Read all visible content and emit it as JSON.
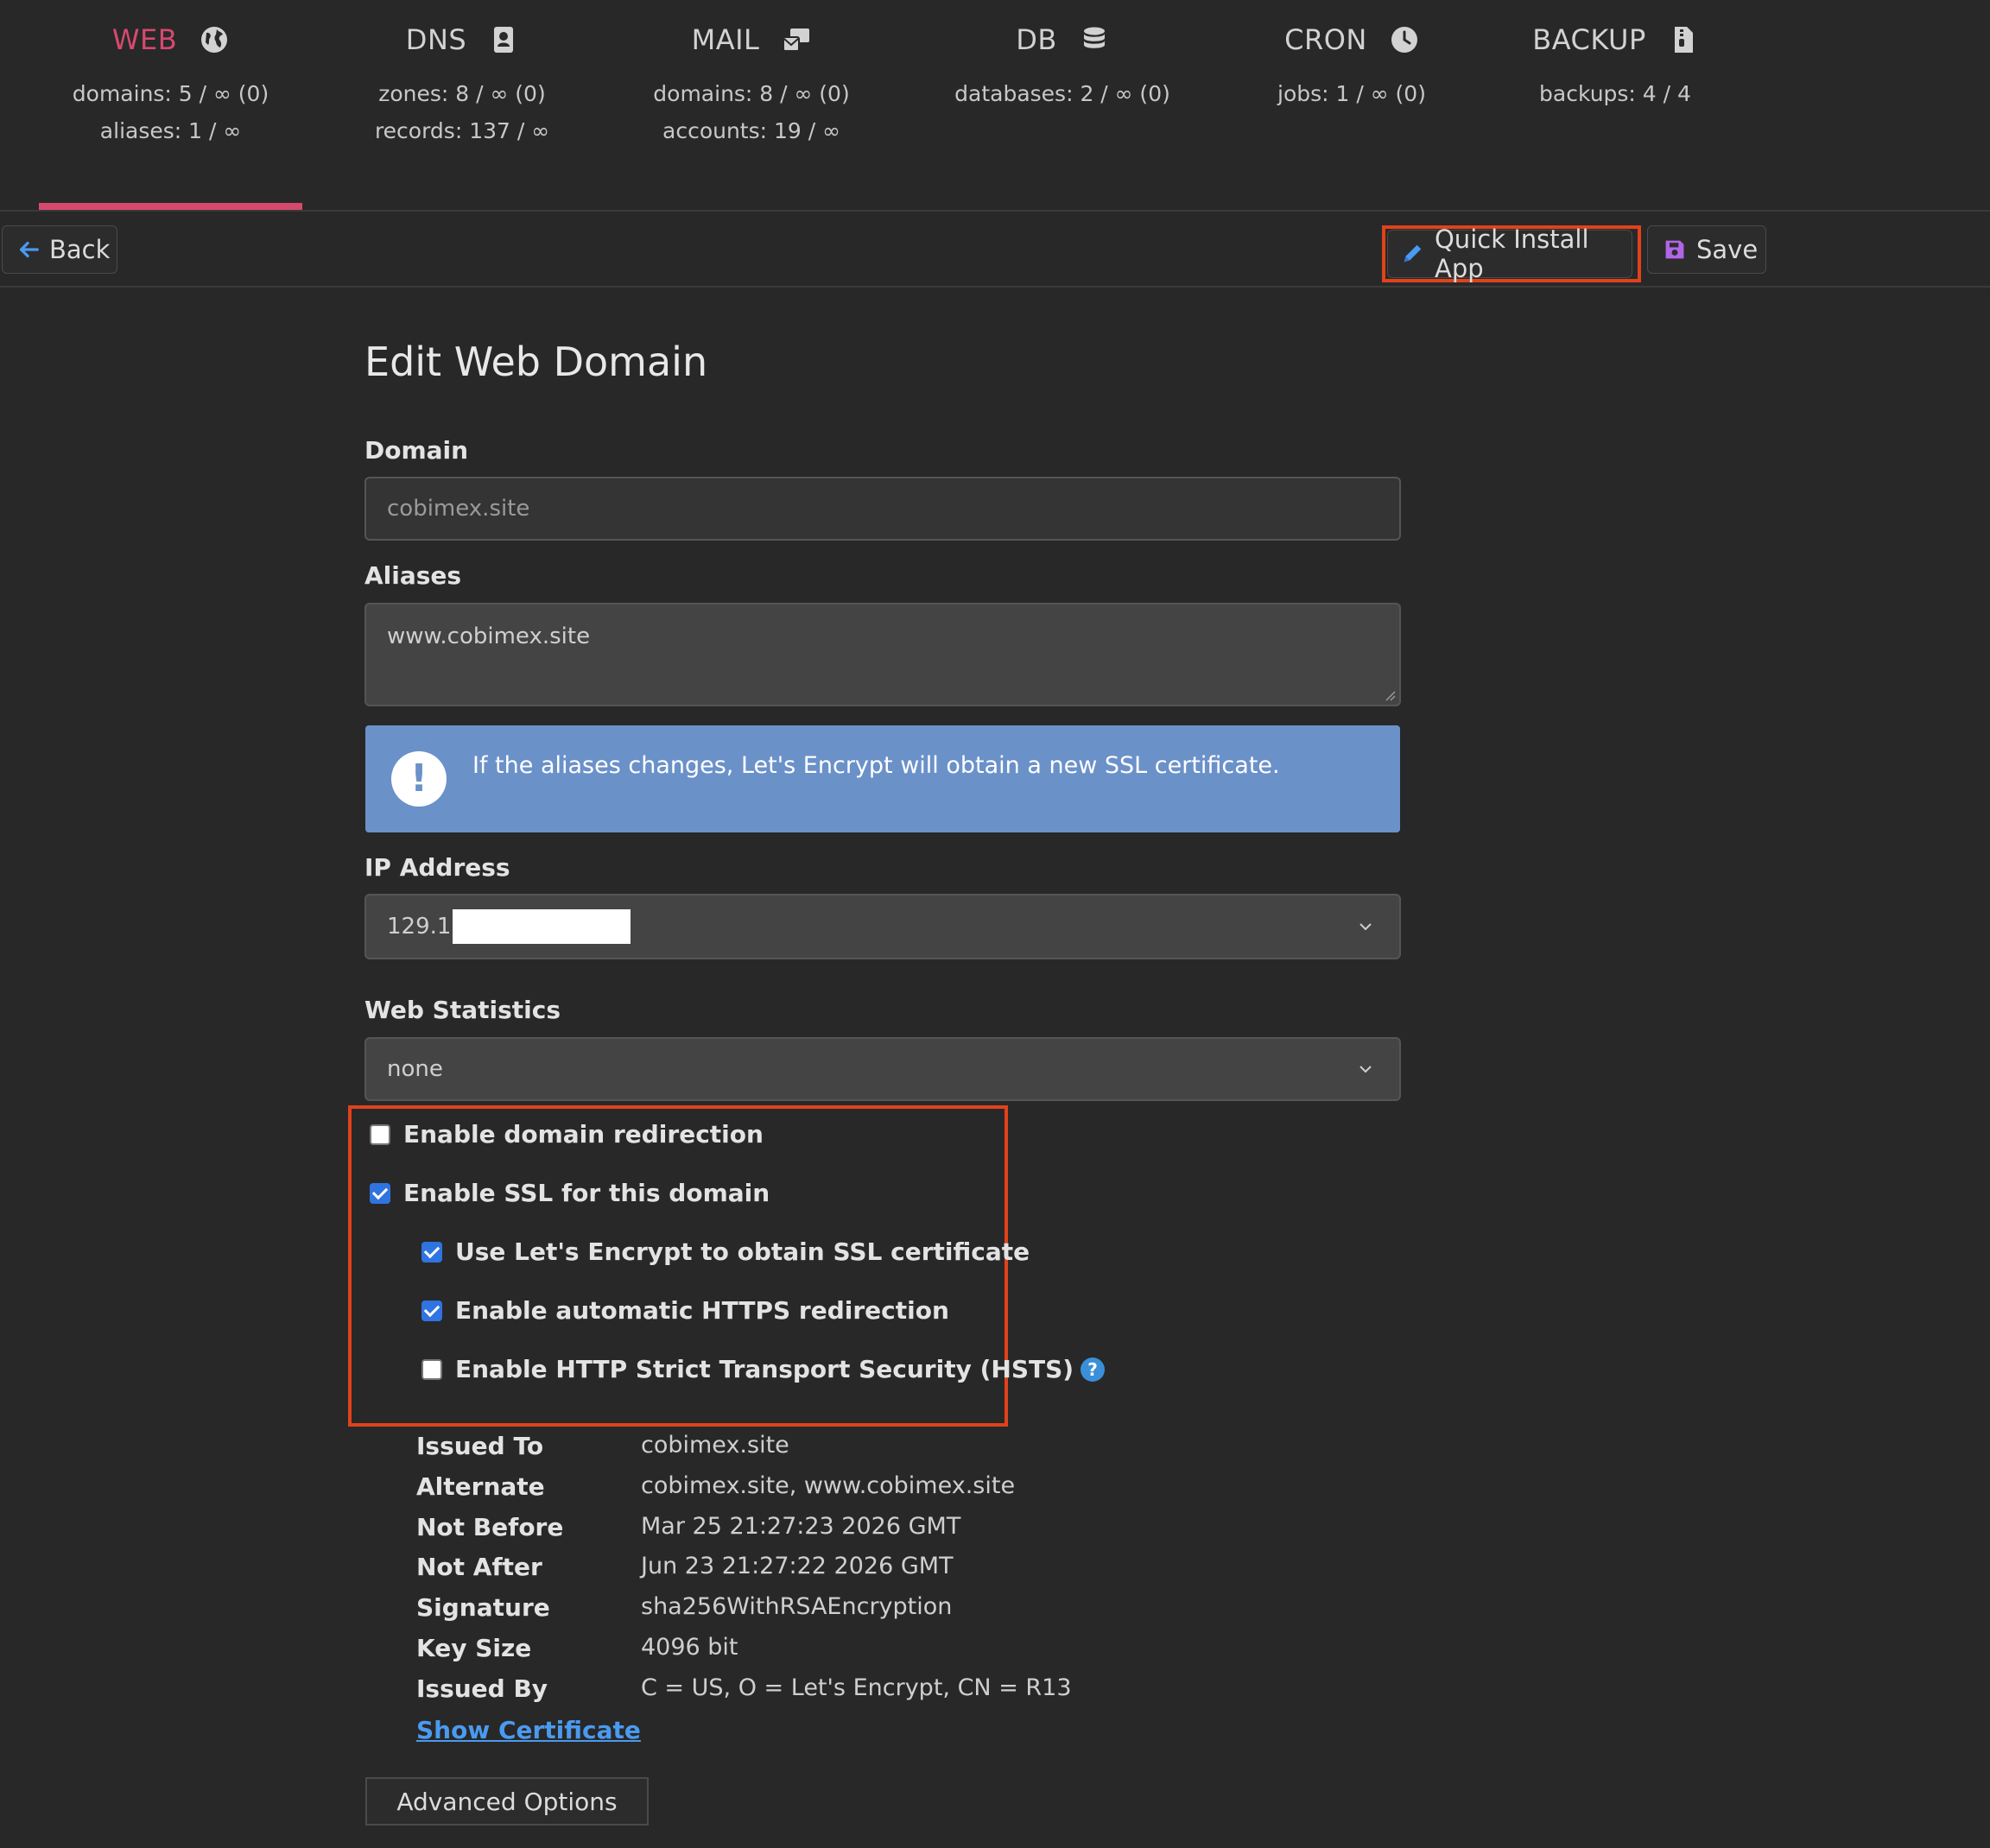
{
  "tabs": [
    {
      "name": "WEB",
      "icon": "globe-icon",
      "line1": "domains: 5 / ∞ (0)",
      "line2": "aliases: 1 / ∞"
    },
    {
      "name": "DNS",
      "icon": "address-book-icon",
      "line1": "zones: 8 / ∞ (0)",
      "line2": "records: 137 / ∞"
    },
    {
      "name": "MAIL",
      "icon": "mail-bulk-icon",
      "line1": "domains: 8 / ∞ (0)",
      "line2": "accounts: 19 / ∞"
    },
    {
      "name": "DB",
      "icon": "database-icon",
      "line1": "databases: 2 / ∞ (0)",
      "line2": ""
    },
    {
      "name": "CRON",
      "icon": "clock-icon",
      "line1": "jobs: 1 / ∞ (0)",
      "line2": ""
    },
    {
      "name": "BACKUP",
      "icon": "file-archive-icon",
      "line1": "backups: 4 / 4",
      "line2": ""
    }
  ],
  "active_tab": "WEB",
  "toolbar": {
    "back_label": "Back",
    "quick_install_label": "Quick Install App",
    "save_label": "Save"
  },
  "form": {
    "title": "Edit Web Domain",
    "domain_label": "Domain",
    "domain_value": "cobimex.site",
    "aliases_label": "Aliases",
    "aliases_value": "www.cobimex.site",
    "alert_text": "If the aliases changes, Let's Encrypt will obtain a new SSL certificate.",
    "ip_label": "IP Address",
    "ip_value": "129.1",
    "stats_label": "Web Statistics",
    "stats_value": "none"
  },
  "options": {
    "redirect": {
      "label": "Enable domain redirection",
      "checked": false
    },
    "ssl": {
      "label": "Enable SSL for this domain",
      "checked": true
    },
    "letsencrypt": {
      "label": "Use Let's Encrypt to obtain SSL certificate",
      "checked": true
    },
    "https_redirect": {
      "label": "Enable automatic HTTPS redirection",
      "checked": true
    },
    "hsts": {
      "label": "Enable HTTP Strict Transport Security (HSTS)",
      "checked": false
    }
  },
  "certificate": {
    "issued_to": {
      "k": "Issued To",
      "v": "cobimex.site"
    },
    "alternate": {
      "k": "Alternate",
      "v": "cobimex.site, www.cobimex.site"
    },
    "not_before": {
      "k": "Not Before",
      "v": "Mar 25 21:27:23 2026 GMT"
    },
    "not_after": {
      "k": "Not After",
      "v": "Jun 23 21:27:22 2026 GMT"
    },
    "signature": {
      "k": "Signature",
      "v": "sha256WithRSAEncryption"
    },
    "key_size": {
      "k": "Key Size",
      "v": "4096 bit"
    },
    "issued_by": {
      "k": "Issued By",
      "v": "C = US, O = Let's Encrypt, CN = R13"
    },
    "show_link": "Show Certificate"
  },
  "advanced_label": "Advanced Options",
  "colors": {
    "accent": "#d6496f",
    "highlight": "#e0421b",
    "alert": "#6b91c9",
    "check": "#2f74e0",
    "link": "#4a9af0"
  }
}
